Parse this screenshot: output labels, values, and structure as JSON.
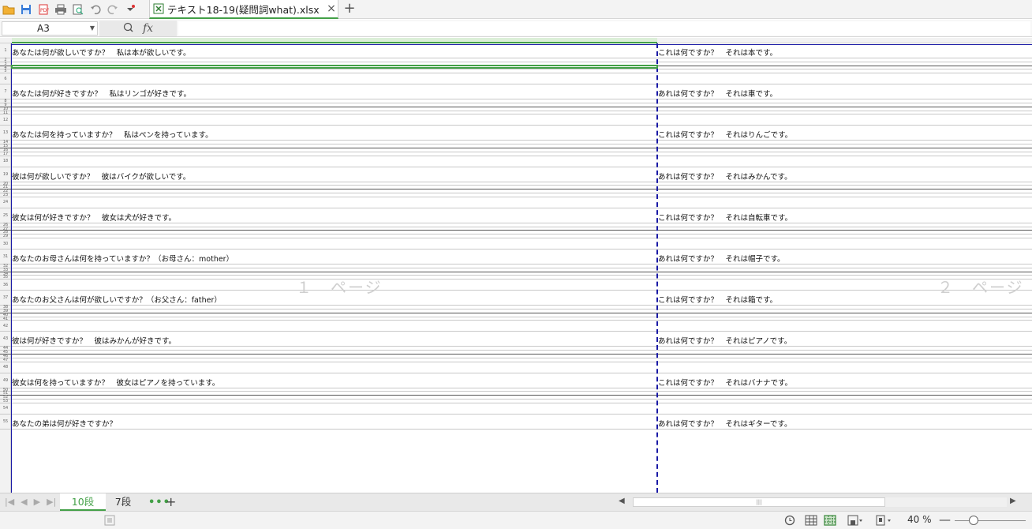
{
  "app": {
    "file_tab": "テキスト18-19(疑問詞what).xlsx",
    "close_glyph": "×",
    "new_tab_glyph": "+"
  },
  "toolbar": {
    "icons": [
      "open-folder-icon",
      "save-icon",
      "pdf-export-icon",
      "print-icon",
      "print-preview-icon",
      "undo-icon",
      "redo-icon",
      "customize-toolbar-icon"
    ]
  },
  "formula_bar": {
    "cell_ref": "A3",
    "fx_label": "fx",
    "formula_value": ""
  },
  "sheet": {
    "rows": [
      {
        "n": "1",
        "a": "あなたは何が欲しいですか？　私は本が欲しいです。",
        "b": "これは何ですか？　それは本です。"
      },
      {
        "n": "2",
        "a": "",
        "b": ""
      },
      {
        "n": "3",
        "a": "",
        "b": ""
      },
      {
        "n": "4",
        "a": "",
        "b": ""
      },
      {
        "n": "5",
        "a": "",
        "b": ""
      },
      {
        "n": "6",
        "a": "",
        "b": ""
      },
      {
        "n": "7",
        "a": "あなたは何が好きですか？　私はリンゴが好きです。",
        "b": "あれは何ですか？　それは車です。"
      },
      {
        "n": "8",
        "a": "",
        "b": ""
      },
      {
        "n": "9",
        "a": "",
        "b": ""
      },
      {
        "n": "10",
        "a": "",
        "b": ""
      },
      {
        "n": "11",
        "a": "",
        "b": ""
      },
      {
        "n": "12",
        "a": "",
        "b": ""
      },
      {
        "n": "13",
        "a": "あなたは何を持っていますか？　私はペンを持っています。",
        "b": "これは何ですか？　それはりんごです。"
      },
      {
        "n": "14",
        "a": "",
        "b": ""
      },
      {
        "n": "15",
        "a": "",
        "b": ""
      },
      {
        "n": "16",
        "a": "",
        "b": ""
      },
      {
        "n": "17",
        "a": "",
        "b": ""
      },
      {
        "n": "18",
        "a": "",
        "b": ""
      },
      {
        "n": "19",
        "a": "彼は何が欲しいですか？　彼はバイクが欲しいです。",
        "b": "あれは何ですか？　それはみかんです。"
      },
      {
        "n": "20",
        "a": "",
        "b": ""
      },
      {
        "n": "21",
        "a": "",
        "b": ""
      },
      {
        "n": "22",
        "a": "",
        "b": ""
      },
      {
        "n": "23",
        "a": "",
        "b": ""
      },
      {
        "n": "24",
        "a": "",
        "b": ""
      },
      {
        "n": "25",
        "a": "彼女は何が好きですか？　彼女は犬が好きです。",
        "b": "これは何ですか？　それは自転車です。"
      },
      {
        "n": "26",
        "a": "",
        "b": ""
      },
      {
        "n": "27",
        "a": "",
        "b": ""
      },
      {
        "n": "28",
        "a": "",
        "b": ""
      },
      {
        "n": "29",
        "a": "",
        "b": ""
      },
      {
        "n": "30",
        "a": "",
        "b": ""
      },
      {
        "n": "31",
        "a": "あなたのお母さんは何を持っていますか？（お母さん：mother）",
        "b": "あれは何ですか？　それは帽子です。"
      },
      {
        "n": "32",
        "a": "",
        "b": ""
      },
      {
        "n": "33",
        "a": "",
        "b": ""
      },
      {
        "n": "34",
        "a": "",
        "b": ""
      },
      {
        "n": "35",
        "a": "",
        "b": ""
      },
      {
        "n": "36",
        "a": "",
        "b": ""
      },
      {
        "n": "37",
        "a": "あなたのお父さんは何が欲しいですか？（お父さん：father）",
        "b": "これは何ですか？　それは箱です。"
      },
      {
        "n": "38",
        "a": "",
        "b": ""
      },
      {
        "n": "39",
        "a": "",
        "b": ""
      },
      {
        "n": "40",
        "a": "",
        "b": ""
      },
      {
        "n": "41",
        "a": "",
        "b": ""
      },
      {
        "n": "42",
        "a": "",
        "b": ""
      },
      {
        "n": "43",
        "a": "彼は何が好きですか？　彼はみかんが好きです。",
        "b": "あれは何ですか？　それはピアノです。"
      },
      {
        "n": "44",
        "a": "",
        "b": ""
      },
      {
        "n": "45",
        "a": "",
        "b": ""
      },
      {
        "n": "46",
        "a": "",
        "b": ""
      },
      {
        "n": "47",
        "a": "",
        "b": ""
      },
      {
        "n": "48",
        "a": "",
        "b": ""
      },
      {
        "n": "49",
        "a": "彼女は何を持っていますか？　彼女はピアノを持っています。",
        "b": "これは何ですか？　それはバナナです。"
      },
      {
        "n": "50",
        "a": "",
        "b": ""
      },
      {
        "n": "51",
        "a": "",
        "b": ""
      },
      {
        "n": "52",
        "a": "",
        "b": ""
      },
      {
        "n": "53",
        "a": "",
        "b": ""
      },
      {
        "n": "54",
        "a": "",
        "b": ""
      },
      {
        "n": "55",
        "a": "あなたの弟は何が好きですか？",
        "b": "あれは何ですか？　それはギターです。"
      }
    ],
    "page_labels": [
      "１　ページ",
      "２　ページ"
    ]
  },
  "sheet_tabs": {
    "tabs": [
      "10段",
      "7段"
    ],
    "active": "10段",
    "more_glyph": "•••",
    "add_glyph": "+"
  },
  "status": {
    "zoom": "40 %",
    "zoom_minus": "—",
    "zoom_level_percent": 40,
    "scroll_thumb": "|||"
  },
  "colors": {
    "accent_green": "#43a047",
    "page_border_blue": "#1a1aa6"
  }
}
